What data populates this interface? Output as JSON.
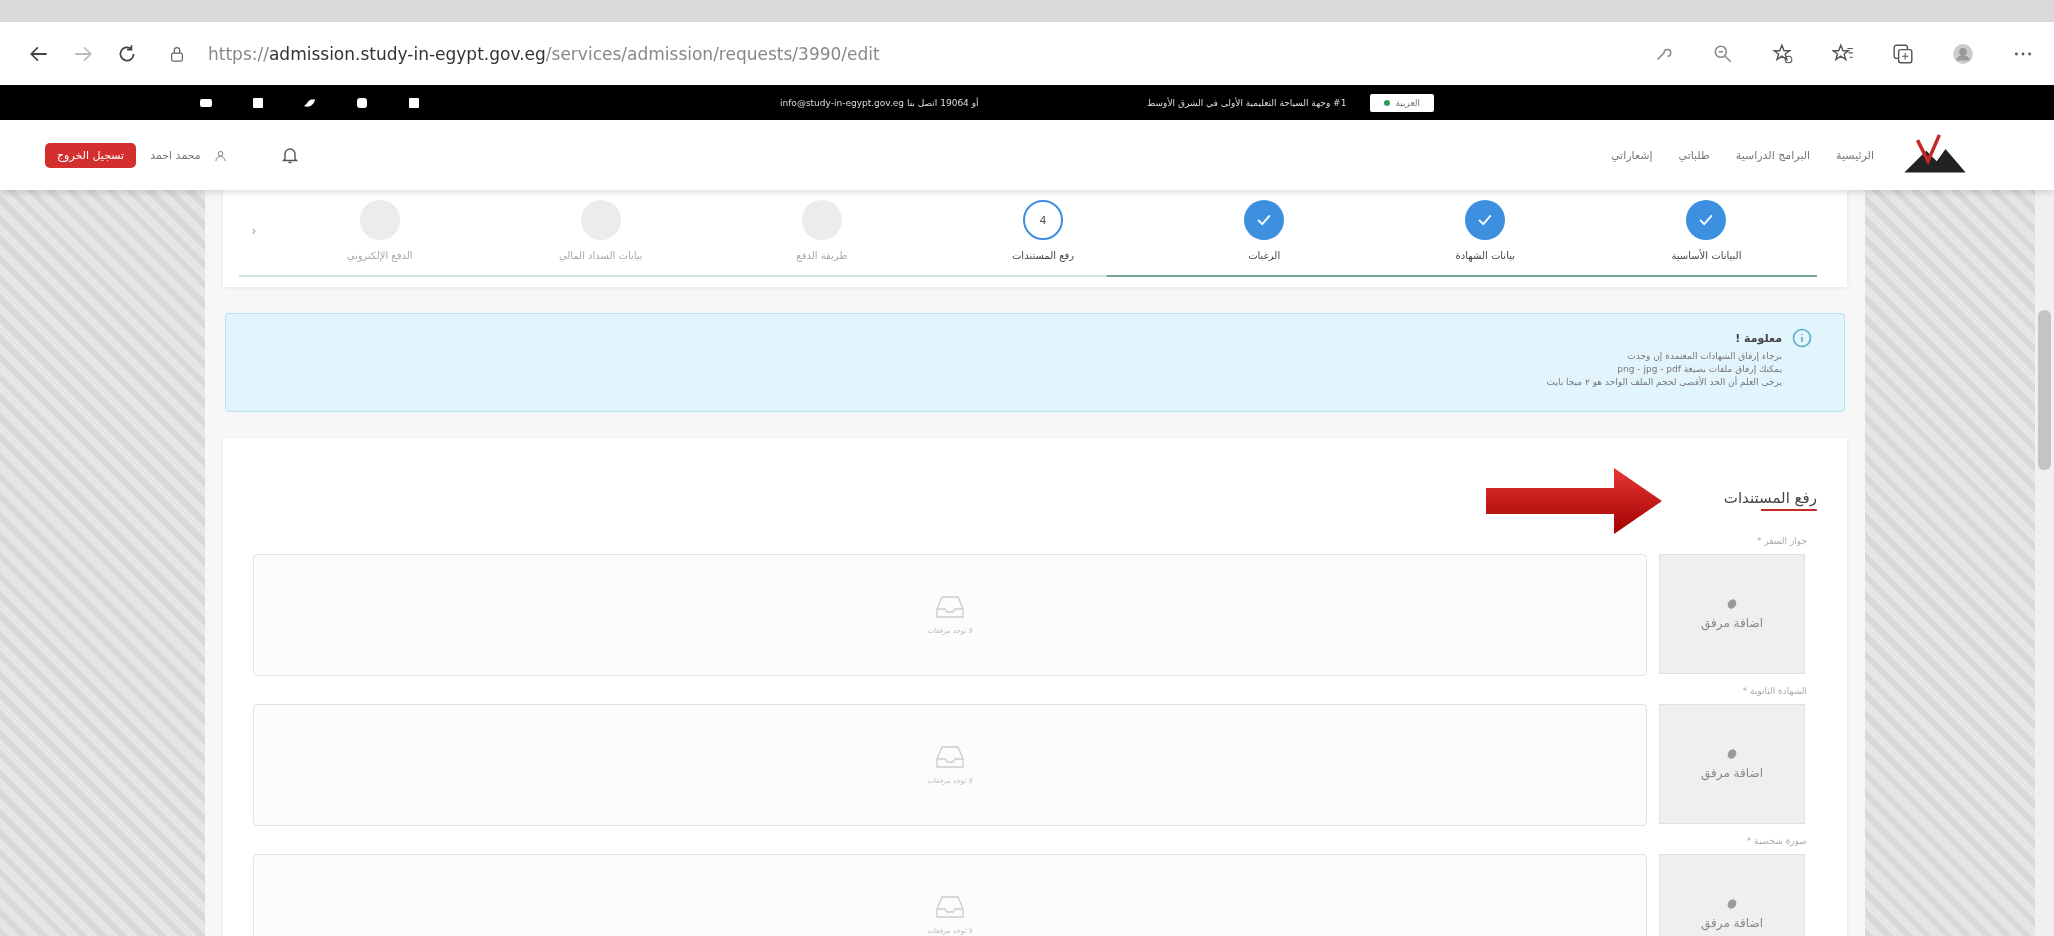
{
  "browser": {
    "url": {
      "scheme": "https://",
      "host": "admission.study-in-egypt.gov.eg",
      "path": "/services/admission/requests/3990/edit"
    }
  },
  "topbar": {
    "contact": "info@study-in-egypt.gov.eg أو 19064 اتصل بنا",
    "tagline": "#1 وجهة السياحة التعليمية الأولى في الشرق الأوسط",
    "language": "العربية"
  },
  "nav": {
    "items": [
      "الرئيسية",
      "البرامج الدراسية",
      "طلباتي",
      "إشعاراتي"
    ],
    "user": "محمد احمد",
    "logout": "تسجيل الخروج"
  },
  "stepper": {
    "prev": "‹",
    "steps": [
      {
        "label": "البيانات الأساسية",
        "completed": true,
        "selected": false
      },
      {
        "label": "بيانات الشهادة",
        "completed": true,
        "selected": false
      },
      {
        "label": "الرغبات",
        "completed": true,
        "selected": false
      },
      {
        "label": "رفع المستندات",
        "completed": false,
        "selected": true,
        "number": "4"
      },
      {
        "label": "طريقة الدفع",
        "completed": false,
        "selected": false
      },
      {
        "label": "بيانات السداد المالي",
        "completed": false,
        "selected": false
      },
      {
        "label": "الدفع الإلكتروني",
        "completed": false,
        "selected": false
      }
    ]
  },
  "info": {
    "title": "معلومة !",
    "lines": [
      "برجاء إرفاق الشهادات المعتمدة إن وجدت",
      "يمكنك إرفاق ملفات بصيغة png - jpg - pdf",
      "يرجى العلم أن الحد الأقصى لحجم الملف الواحد هو ٢ ميجا بايت"
    ]
  },
  "upload": {
    "title": "رفع المستندات",
    "fields": [
      {
        "label": "جواز السفر *",
        "button": "اضافة مرفق",
        "empty_text": "لا توجد مرفقات"
      },
      {
        "label": "الشهادة الثانوية *",
        "button": "اضافة مرفق",
        "empty_text": "لا توجد مرفقات"
      },
      {
        "label": "صورة شخصية *",
        "button": "اضافة مرفق",
        "empty_text": "لا توجد مرفقات"
      }
    ]
  }
}
